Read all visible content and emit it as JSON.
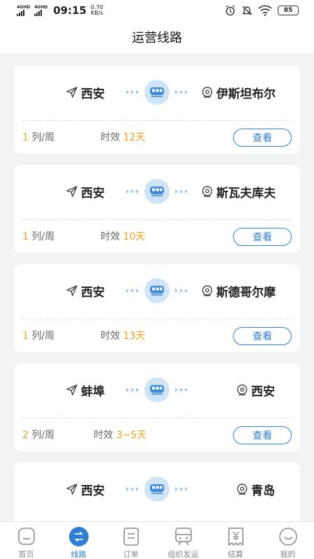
{
  "status_bar": {
    "network_1": "4GHD",
    "network_2": "4GHD",
    "time": "09:15",
    "speed_value": "0.70",
    "speed_unit": "KB/s",
    "battery": "85"
  },
  "header": {
    "title": "运营线路"
  },
  "routes": [
    {
      "origin": "西安",
      "destination": "伊斯坦布尔",
      "frequency_num": "1",
      "frequency_unit": "列/周",
      "timeliness_label": "时效",
      "timeliness_value": "12天",
      "button": "查看"
    },
    {
      "origin": "西安",
      "destination": "斯瓦夫库夫",
      "frequency_num": "1",
      "frequency_unit": "列/周",
      "timeliness_label": "时效",
      "timeliness_value": "10天",
      "button": "查看"
    },
    {
      "origin": "西安",
      "destination": "斯德哥尔摩",
      "frequency_num": "1",
      "frequency_unit": "列/周",
      "timeliness_label": "时效",
      "timeliness_value": "13天",
      "button": "查看"
    },
    {
      "origin": "蚌埠",
      "destination": "西安",
      "frequency_num": "2",
      "frequency_unit": "列/周",
      "timeliness_label": "时效",
      "timeliness_value": "3~5天",
      "button": "查看"
    },
    {
      "origin": "西安",
      "destination": "青岛",
      "frequency_num": "",
      "frequency_unit": "",
      "timeliness_label": "",
      "timeliness_value": "",
      "button": ""
    }
  ],
  "tabbar": {
    "items": [
      {
        "label": "首页",
        "icon": "home-icon"
      },
      {
        "label": "线路",
        "icon": "route-icon",
        "active": true
      },
      {
        "label": "订单",
        "icon": "order-icon"
      },
      {
        "label": "组织发运",
        "icon": "train-icon"
      },
      {
        "label": "结算",
        "icon": "settlement-icon"
      },
      {
        "label": "我的",
        "icon": "profile-icon"
      }
    ]
  },
  "colors": {
    "accent": "#2f7fd6",
    "highlight": "#f0a020",
    "train_circle": "#cfe5f7"
  }
}
